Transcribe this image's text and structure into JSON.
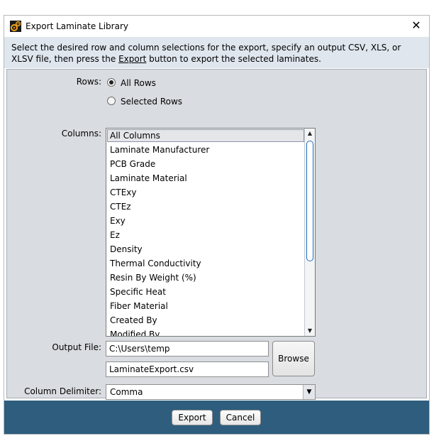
{
  "window": {
    "title": "Export Laminate Library",
    "close_glyph": "✕",
    "icon": "gear-app-icon"
  },
  "instructions": {
    "part1": "Select the desired row and column selections for the export, specify an output CSV, XLS, or XLSV file, then press the ",
    "link": "Export",
    "part2": " button to export the selected laminates."
  },
  "rows": {
    "label": "Rows:",
    "options": [
      {
        "label": "All Rows",
        "selected": true
      },
      {
        "label": "Selected Rows",
        "selected": false
      }
    ]
  },
  "columns": {
    "label": "Columns:",
    "items": [
      "All Columns",
      "Laminate Manufacturer",
      "PCB Grade",
      "Laminate Material",
      "CTExy",
      "CTEz",
      "Exy",
      "Ez",
      "Density",
      "Thermal Conductivity",
      "Resin By Weight (%)",
      "Specific Heat",
      "Fiber Material",
      "Created By",
      "Modified By"
    ],
    "selected_index": 0
  },
  "output_file": {
    "label": "Output File:",
    "directory": "C:\\Users\\temp",
    "filename": "LaminateExport.csv",
    "browse_label": "Browse"
  },
  "delimiter": {
    "label": "Column Delimiter:",
    "value": "Comma"
  },
  "footer": {
    "export_label": "Export",
    "cancel_label": "Cancel"
  },
  "colors": {
    "header_bg": "#dfe6ee",
    "content_bg": "#d9dce0",
    "footer_bg": "#2e5d7e",
    "scroll_thumb": "#1e6fbf"
  }
}
